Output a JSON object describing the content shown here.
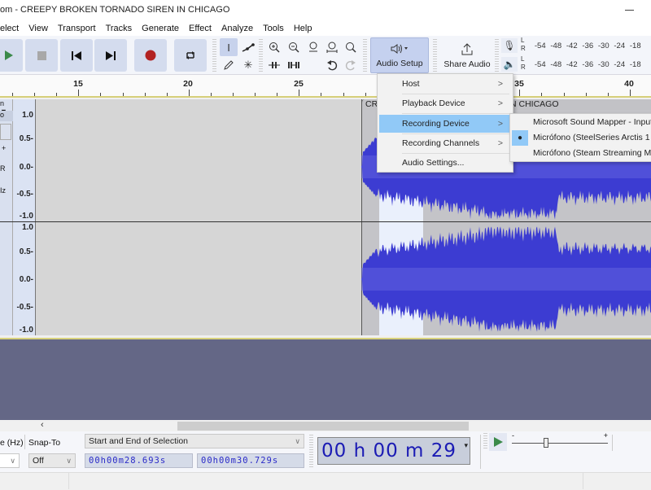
{
  "window": {
    "title": "om - CREEPY BROKEN TORNADO SIREN IN CHICAGO",
    "minimize_icon": "minimize-icon"
  },
  "menubar": [
    "elect",
    "View",
    "Transport",
    "Tracks",
    "Generate",
    "Effect",
    "Analyze",
    "Tools",
    "Help"
  ],
  "transport": {
    "play": "play-icon",
    "stop": "stop-icon",
    "skip_start": "skip-start-icon",
    "skip_end": "skip-end-icon",
    "record": "record-icon",
    "loop": "loop-icon",
    "play_color": "#3b8a4a",
    "record_color": "#b22222"
  },
  "tools": {
    "selection": "I",
    "envelope": "envelope-icon",
    "draw": "pencil-icon",
    "multi": "✳",
    "zoom_in": "zoom-in-icon",
    "zoom_out": "zoom-out-icon",
    "fit_selection": "fit-selection-icon",
    "fit_project": "fit-project-icon",
    "zoom_toggle": "zoom-toggle-icon",
    "trim": "trim-icon",
    "silence": "silence-icon",
    "undo": "undo-icon",
    "redo": "redo-icon"
  },
  "audio_setup": {
    "label": "Audio Setup"
  },
  "share_audio": {
    "label": "Share Audio"
  },
  "meters": {
    "record_lr": "L\nR",
    "play_lr": "L\nR",
    "scale": [
      "-54",
      "-48",
      "-42",
      "-36",
      "-30",
      "-24",
      "-18"
    ]
  },
  "ruler": {
    "labels": [
      "15",
      "20",
      "25",
      "35",
      "40"
    ]
  },
  "track": {
    "menu_fragment": "n ▼",
    "mute_fragment": "o",
    "rate_fragment": "Iz",
    "clip_name": "CRE",
    "clip_name_tail": "N CHICAGO",
    "scale_ch1": [
      "1.0",
      "0.5-",
      "0.0-",
      "-0.5-",
      "-1.0"
    ],
    "scale_ch2": [
      "1.0",
      "0.5-",
      "0.0-",
      "-0.5-",
      "-1.0"
    ],
    "wave_color": "#3c3cd2",
    "selection_color": "#eaf0fc"
  },
  "audio_setup_menu": {
    "items": [
      {
        "label": "Host",
        "arrow": ">"
      },
      {
        "label": "Playback Device",
        "arrow": ">"
      },
      {
        "label": "Recording Device",
        "arrow": ">",
        "highlighted": true
      },
      {
        "label": "Recording Channels",
        "arrow": ">"
      },
      {
        "label": "Audio Settings...",
        "arrow": ""
      }
    ]
  },
  "recording_device_submenu": {
    "items": [
      {
        "label": "Microsoft Sound Mapper - Input",
        "checked": false
      },
      {
        "label": "Micrófono (SteelSeries Arctis 1",
        "checked": true
      },
      {
        "label": "Micrófono (Steam Streaming Mic",
        "checked": false
      }
    ]
  },
  "selection_toolbar": {
    "rate_label": "e (Hz)",
    "snap_label": "Snap-To",
    "snap_value": "Off",
    "mode": "Start and End of Selection",
    "start": "00h00m28.693s",
    "end": "00h00m30.729s"
  },
  "time_toolbar": {
    "value": "00 h 00 m 29 s"
  },
  "play_at_speed": {
    "min": "-",
    "max": "+",
    "speed_fraction": 0.35
  },
  "scroll": {
    "left_arrow": "‹"
  }
}
